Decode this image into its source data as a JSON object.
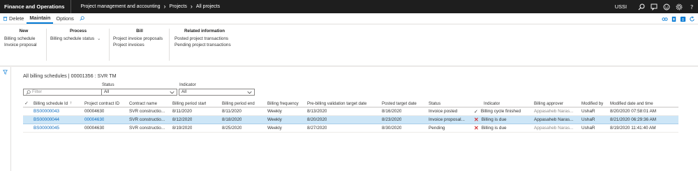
{
  "topbar": {
    "app_name": "Finance and Operations",
    "breadcrumbs": [
      "Project management and accounting",
      "Projects",
      "All projects"
    ],
    "company": "USSI",
    "icons": [
      "search-icon",
      "chat-icon",
      "smiley-icon",
      "gear-icon"
    ]
  },
  "action_pane": {
    "delete_label": "Delete",
    "tabs": [
      "Maintain",
      "Options"
    ],
    "active_tab": "Maintain"
  },
  "ribbon": {
    "new": {
      "title": "New",
      "items": [
        "Billing schedule",
        "Invoice proposal"
      ]
    },
    "process": {
      "title": "Process",
      "items": [
        "Billing schedule status"
      ]
    },
    "bill": {
      "title": "Bill",
      "items": [
        "Project invoice proposals",
        "Project invoices"
      ]
    },
    "related": {
      "title": "Related information",
      "items": [
        "Posted project transactions",
        "Pending project transactions"
      ]
    }
  },
  "page": {
    "caption": "All billing schedules | 00001356 : SVR TM",
    "filter_placeholder": "Filter",
    "status_label": "Status",
    "status_value": "All",
    "indicator_label": "Indicator",
    "indicator_value": "All"
  },
  "grid": {
    "columns": [
      "Billing schedule Id",
      "Project contract ID",
      "Contract name",
      "Billing period start",
      "Billing period end",
      "Billing frequency",
      "Pre-billing validation target date",
      "Posted target date",
      "Status",
      "Indicator",
      "Billing approver",
      "Modified by",
      "Modified date and time"
    ],
    "rows": [
      {
        "id": "BS00000043",
        "contract_id": "00004630",
        "contract_name": "SVR constructio...",
        "period_start": "8/11/2020",
        "period_end": "8/11/2020",
        "frequency": "Weekly",
        "prebill_date": "8/13/2020",
        "posted_date": "8/16/2020",
        "status": "Invoice posted",
        "indicator": "Billing cycle finished",
        "indicator_icon": "check-icon",
        "approver": "Appasaheb Naras...",
        "modified_by": "UshaR",
        "modified_at": "8/20/2020 07:58:01 AM"
      },
      {
        "id": "BS00000044",
        "contract_id": "00004630",
        "contract_name": "SVR constructio...",
        "period_start": "8/12/2020",
        "period_end": "8/18/2020",
        "frequency": "Weekly",
        "prebill_date": "8/20/2020",
        "posted_date": "8/23/2020",
        "status": "Invoice proposal...",
        "indicator": "Billing is due",
        "indicator_icon": "x-icon",
        "approver": "Appasaheb Naras...",
        "modified_by": "UshaR",
        "modified_at": "8/21/2020 06:29:36 AM"
      },
      {
        "id": "BS00000045",
        "contract_id": "00004630",
        "contract_name": "SVR constructio...",
        "period_start": "8/19/2020",
        "period_end": "8/25/2020",
        "frequency": "Weekly",
        "prebill_date": "8/27/2020",
        "posted_date": "8/30/2020",
        "status": "Pending",
        "indicator": "Billing is due",
        "indicator_icon": "x-icon",
        "approver": "Appasaheb Naras...",
        "modified_by": "UshaR",
        "modified_at": "8/19/2020 11:41:40 AM"
      }
    ]
  },
  "colors": {
    "topbar_bg": "#1e1e1e",
    "accent": "#0078d4",
    "link": "#0f6cbd",
    "selected_row": "#cde6f7",
    "error_x": "#d13438"
  }
}
